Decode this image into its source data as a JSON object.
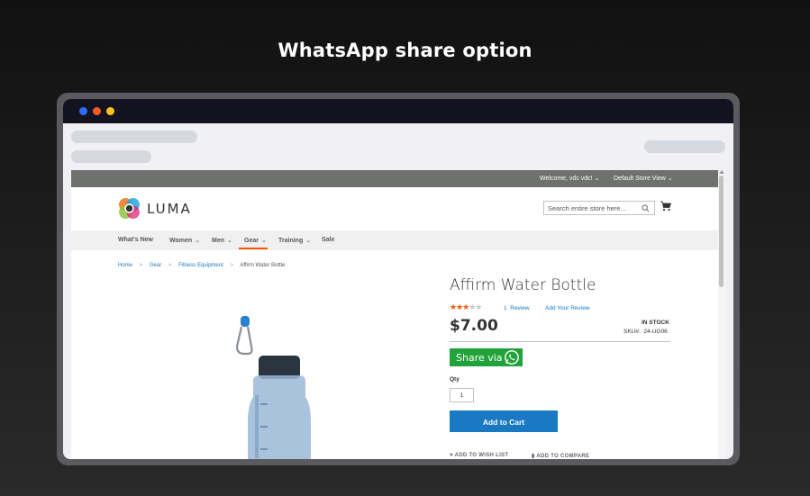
{
  "hero": {
    "title": "WhatsApp share option"
  },
  "colors": {
    "background_top": "#111111",
    "background_bottom": "#2a2a2a",
    "frame": "#5a5a5f",
    "titlebar": "#13131f",
    "accent_blue": "#1979c3",
    "accent_orange": "#ff5501",
    "whatsapp_green": "#22a33a"
  },
  "browser": {
    "window_controls": [
      "blue-dot",
      "orange-dot",
      "yellow-dot"
    ]
  },
  "site": {
    "topbar": {
      "welcome": "Welcome, vdc vdc!",
      "store_view": "Default Store View"
    },
    "logo": {
      "text": "LUMA",
      "icon": "luma-logo-icon"
    },
    "search": {
      "placeholder": "Search entire store here..."
    },
    "nav": {
      "items": [
        {
          "label": "What's New",
          "has_dropdown": false
        },
        {
          "label": "Women",
          "has_dropdown": true
        },
        {
          "label": "Men",
          "has_dropdown": true
        },
        {
          "label": "Gear",
          "has_dropdown": true,
          "active": true
        },
        {
          "label": "Training",
          "has_dropdown": true
        },
        {
          "label": "Sale",
          "has_dropdown": false
        }
      ]
    },
    "breadcrumb": {
      "items": [
        "Home",
        "Gear",
        "Fitness Equipment"
      ],
      "current": "Affirm Water Bottle",
      "separator": ">"
    },
    "product": {
      "title": "Affirm Water Bottle",
      "rating": {
        "filled": 3,
        "total": 5
      },
      "review_count": "1",
      "review_label": "Review",
      "add_review": "Add Your Review",
      "price": "$7.00",
      "stock": "IN STOCK",
      "sku_label": "SKU#:",
      "sku_value": "24-UG06",
      "share_label": "Share via",
      "qty_label": "Qty",
      "qty_value": "1",
      "add_to_cart": "Add to Cart",
      "wishlist": "ADD TO WISH LIST",
      "compare": "ADD TO COMPARE"
    }
  }
}
